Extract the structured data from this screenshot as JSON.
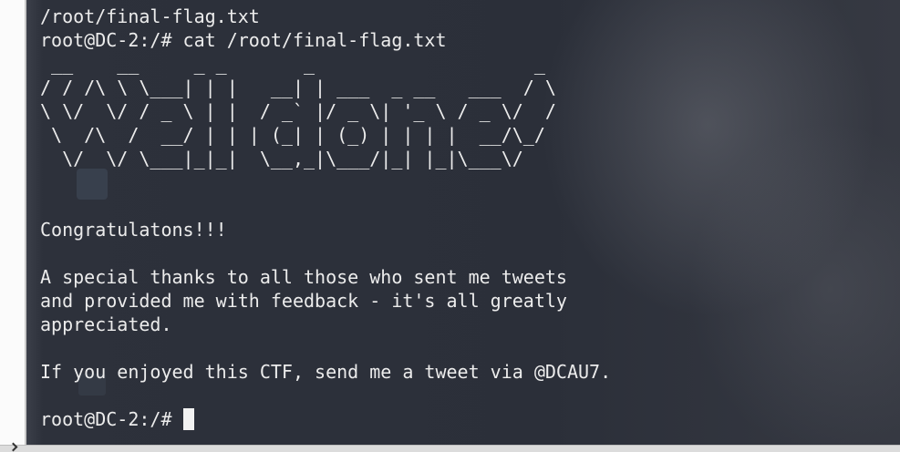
{
  "terminal": {
    "lines": [
      "/root/final-flag.txt",
      "root@DC-2:/# cat /root/final-flag.txt",
      " __    __     _ _       _                    _ ",
      "/ / /\\ \\ \\___| | |   __| | ___  _ __   ___  / \\",
      "\\ \\/  \\/ / _ \\ | |  / _` |/ _ \\| '_ \\ / _ \\/  /",
      " \\  /\\  /  __/ | | | (_| | (_) | | | |  __/\\_/ ",
      "  \\/  \\/ \\___|_|_|  \\__,_|\\___/|_| |_|\\___\\/   ",
      "",
      "",
      "Congratulatons!!!",
      "",
      "A special thanks to all those who sent me tweets",
      "and provided me with feedback - it's all greatly",
      "appreciated.",
      "",
      "If you enjoyed this CTF, send me a tweet via @DCAU7.",
      ""
    ],
    "prompt": "root@DC-2:/# "
  },
  "icons": {
    "bottom_left": "chevron-right-icon",
    "cursor": "block-cursor"
  },
  "colors": {
    "terminal_background": "#2b2f39",
    "terminal_text": "#ececec",
    "side_panel": "#fbfbfb"
  }
}
